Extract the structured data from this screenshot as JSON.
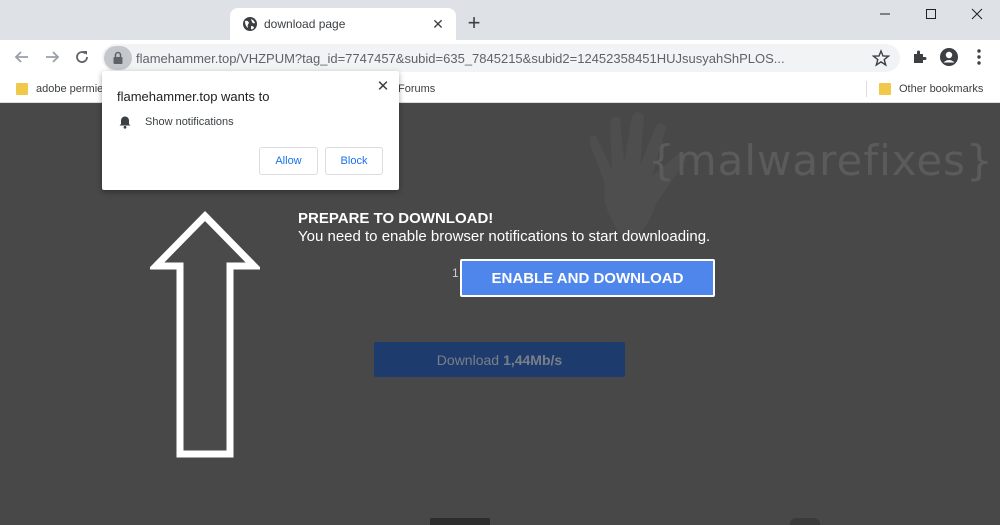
{
  "tab": {
    "title": "download page",
    "close": "✕",
    "new_tab": "+"
  },
  "window": {
    "minimize": "—",
    "maximize": "☐",
    "close": "✕"
  },
  "toolbar": {
    "url": "flamehammer.top/VHZPUM?tag_id=7747457&subid=635_7845215&subid2=12452358451HUJsusyahShPLOS..."
  },
  "bookmarks": {
    "items": [
      {
        "label": "adobe permie",
        "icon": "folder-icon"
      },
      {
        "label": "Forums",
        "icon": ""
      },
      {
        "label": "Other bookmarks",
        "icon": "folder-icon"
      }
    ]
  },
  "popup": {
    "title": "flamehammer.top wants to",
    "close": "✕",
    "permission": "Show notifications",
    "allow_label": "Allow",
    "block_label": "Block"
  },
  "page": {
    "watermark": "{malwarefixes}",
    "prep_title": "PREPARE TO DOWNLOAD!",
    "prep_sub": "You need to enable browser notifications to start downloading.",
    "small_digit": "1",
    "enable_label": "ENABLE AND DOWNLOAD",
    "download_prefix": "Download",
    "download_speed": "1,44Mb/s"
  },
  "colors": {
    "accent": "#4f86ec",
    "page_bg": "#484848",
    "download_btn": "#1e3b6e",
    "link_blue": "#1a73e8",
    "tabstrip": "#dee1e6"
  }
}
